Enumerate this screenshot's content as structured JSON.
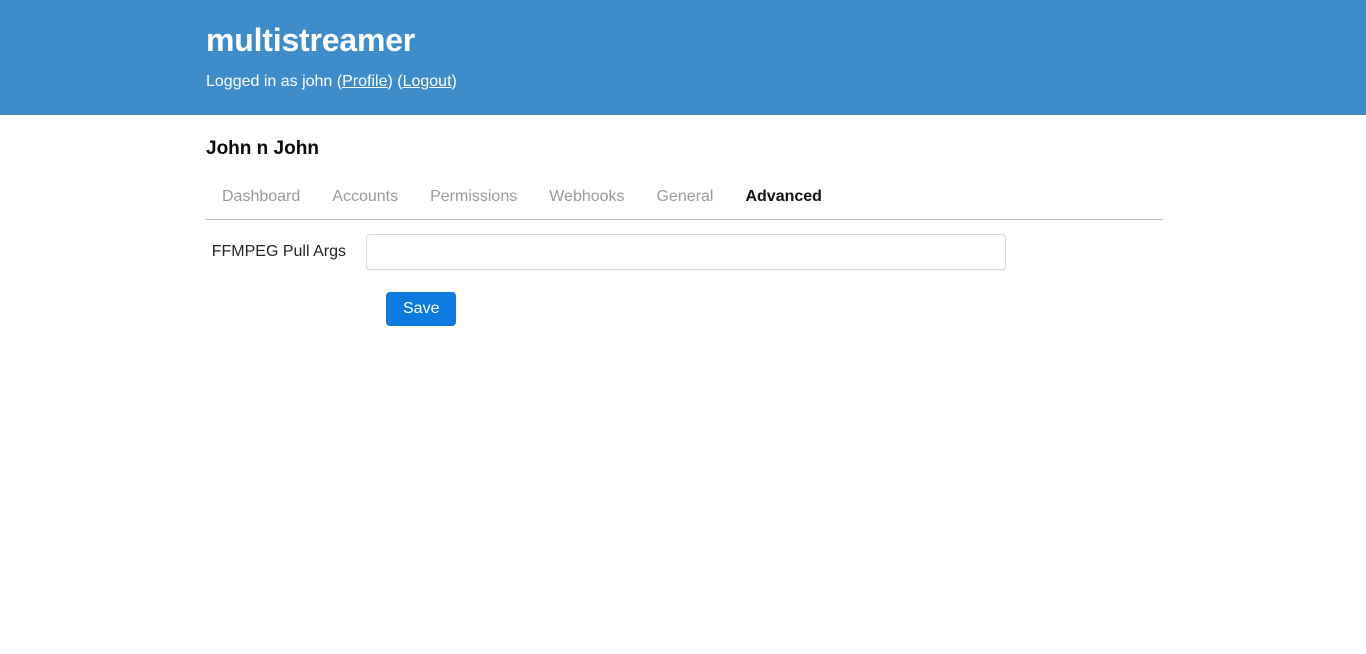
{
  "header": {
    "app_title": "multistreamer",
    "session_prefix": "Logged in as john (",
    "profile_link": "Profile",
    "between_links": ") (",
    "logout_link": "Logout",
    "session_suffix": ")",
    "background_color": "#3f8ccb"
  },
  "page": {
    "title": "John n John"
  },
  "tabs": [
    {
      "label": "Dashboard",
      "active": false
    },
    {
      "label": "Accounts",
      "active": false
    },
    {
      "label": "Permissions",
      "active": false
    },
    {
      "label": "Webhooks",
      "active": false
    },
    {
      "label": "General",
      "active": false
    },
    {
      "label": "Advanced",
      "active": true
    }
  ],
  "form": {
    "fields": [
      {
        "label": "FFMPEG Pull Args",
        "value": "",
        "placeholder": ""
      }
    ],
    "save_label": "Save",
    "save_color": "#0d7ae0"
  }
}
